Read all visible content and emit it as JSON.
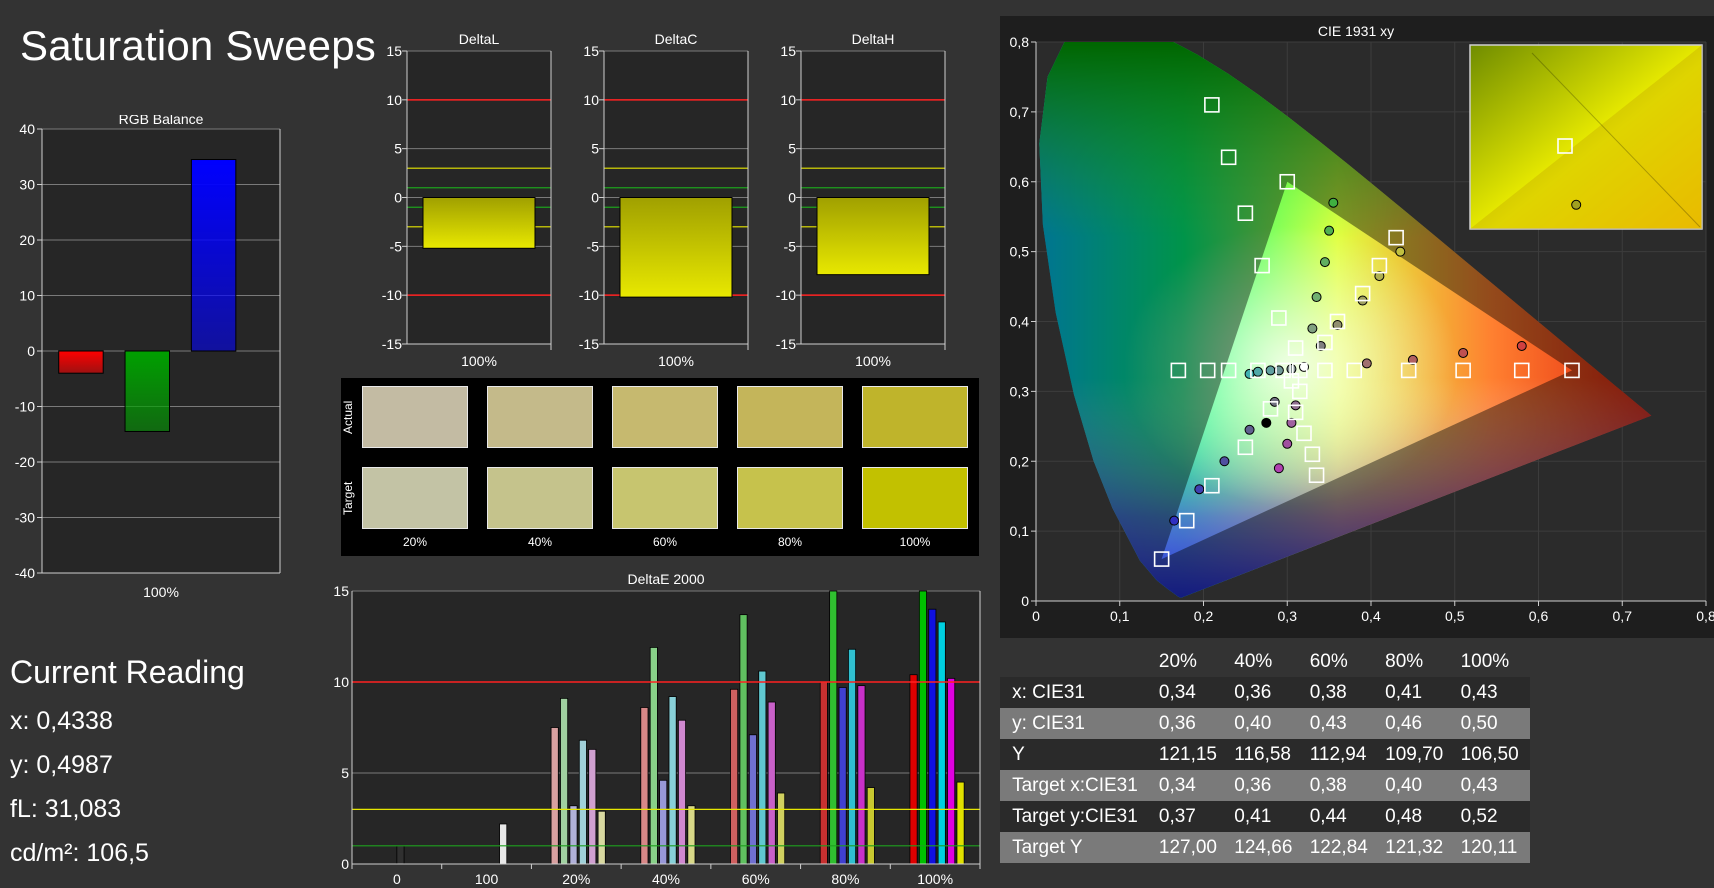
{
  "title": "Saturation Sweeps",
  "current_reading": {
    "title": "Current Reading",
    "lines": [
      "x: 0,4338",
      "y: 0,4987",
      "fL: 31,083",
      "cd/m²: 106,5"
    ]
  },
  "colors": {
    "background": "#333333",
    "panel": "#262626",
    "red_limit": "#ff2020",
    "yellow_limit": "#e6e600",
    "green_limit": "#1ea01e"
  },
  "chart_data": [
    {
      "id": "rgb-balance",
      "type": "bar",
      "title": "RGB Balance",
      "categories": [
        "Red",
        "Green",
        "Blue"
      ],
      "values": [
        -4,
        -14.5,
        34.5
      ],
      "colors": [
        "#ff0000",
        "#00a000",
        "#0000ff"
      ],
      "xlabel": "100%",
      "ylim": [
        -40,
        40
      ],
      "yticks": [
        "40",
        "30",
        "20",
        "10",
        "0",
        "-10",
        "-20",
        "-30",
        "-40"
      ]
    },
    {
      "id": "delta-l",
      "type": "bar",
      "title": "DeltaL",
      "categories": [
        "100%"
      ],
      "values": [
        -5.2
      ],
      "ylim": [
        -15,
        15
      ],
      "yticks": [
        "15",
        "10",
        "5",
        "0",
        "-5",
        "-10",
        "-15"
      ],
      "xlabel": "100%"
    },
    {
      "id": "delta-c",
      "type": "bar",
      "title": "DeltaC",
      "categories": [
        "100%"
      ],
      "values": [
        -10.2
      ],
      "ylim": [
        -15,
        15
      ],
      "yticks": [
        "15",
        "10",
        "5",
        "0",
        "-5",
        "-10",
        "-15"
      ],
      "xlabel": "100%"
    },
    {
      "id": "delta-h",
      "type": "bar",
      "title": "DeltaH",
      "categories": [
        "100%"
      ],
      "values": [
        -7.9
      ],
      "ylim": [
        -15,
        15
      ],
      "yticks": [
        "15",
        "10",
        "5",
        "0",
        "-5",
        "-10",
        "-15"
      ],
      "xlabel": "100%"
    },
    {
      "id": "delta-e-2000",
      "type": "bar",
      "title": "DeltaE 2000",
      "ylim": [
        0,
        15
      ],
      "yticks": [
        "15",
        "10",
        "5",
        "0"
      ],
      "xticks": [
        "0",
        "100",
        "20%",
        "40%",
        "60%",
        "80%",
        "100%"
      ],
      "limit_lines": [
        10,
        3,
        1
      ],
      "groups": [
        {
          "label": "0",
          "bars": [
            {
              "value": 1.0,
              "color": "#303030"
            }
          ]
        },
        {
          "label": "100",
          "bars": [
            {
              "value": 2.2,
              "color": "#e8e8e8"
            }
          ]
        },
        {
          "label": "20%",
          "bars": [
            {
              "value": 7.5,
              "color": "#d8a0a0"
            },
            {
              "value": 9.1,
              "color": "#a0d0a0"
            },
            {
              "value": 3.2,
              "color": "#b0b0d8"
            },
            {
              "value": 6.8,
              "color": "#a0d0d8"
            },
            {
              "value": 6.3,
              "color": "#d0a0d0"
            },
            {
              "value": 2.9,
              "color": "#d8d8a0"
            }
          ]
        },
        {
          "label": "40%",
          "bars": [
            {
              "value": 8.6,
              "color": "#d88888"
            },
            {
              "value": 11.9,
              "color": "#88d088"
            },
            {
              "value": 4.6,
              "color": "#9898d8"
            },
            {
              "value": 9.2,
              "color": "#88d0d8"
            },
            {
              "value": 7.9,
              "color": "#d088d0"
            },
            {
              "value": 3.2,
              "color": "#d8d888"
            }
          ]
        },
        {
          "label": "60%",
          "bars": [
            {
              "value": 9.6,
              "color": "#d06060"
            },
            {
              "value": 13.7,
              "color": "#60c060"
            },
            {
              "value": 7.1,
              "color": "#7070d0"
            },
            {
              "value": 10.6,
              "color": "#60c8d0"
            },
            {
              "value": 8.9,
              "color": "#c860c8"
            },
            {
              "value": 3.9,
              "color": "#d0d060"
            }
          ]
        },
        {
          "label": "80%",
          "bars": [
            {
              "value": 10.0,
              "color": "#c83030"
            },
            {
              "value": 15.0,
              "color": "#30c030"
            },
            {
              "value": 9.7,
              "color": "#4040d0"
            },
            {
              "value": 11.8,
              "color": "#30c0d0"
            },
            {
              "value": 9.8,
              "color": "#c830c8"
            },
            {
              "value": 4.2,
              "color": "#c8c830"
            }
          ]
        },
        {
          "label": "100%",
          "bars": [
            {
              "value": 10.4,
              "color": "#e00000"
            },
            {
              "value": 15.0,
              "color": "#00c000"
            },
            {
              "value": 14.0,
              "color": "#1010e0"
            },
            {
              "value": 13.3,
              "color": "#00d0e0"
            },
            {
              "value": 10.2,
              "color": "#e000e0"
            },
            {
              "value": 4.5,
              "color": "#e0e000"
            }
          ]
        }
      ]
    },
    {
      "id": "cie-1931",
      "type": "scatter",
      "title": "CIE 1931 xy",
      "xlim": [
        0,
        0.8
      ],
      "ylim": [
        0,
        0.8
      ],
      "xticks": [
        "0",
        "0,1",
        "0,2",
        "0,3",
        "0,4",
        "0,5",
        "0,6",
        "0,7",
        "0,8"
      ],
      "yticks": [
        "0",
        "0,1",
        "0,2",
        "0,3",
        "0,4",
        "0,5",
        "0,6",
        "0,7",
        "0,8"
      ],
      "targets": [
        [
          0.64,
          0.33
        ],
        [
          0.58,
          0.33
        ],
        [
          0.51,
          0.33
        ],
        [
          0.445,
          0.33
        ],
        [
          0.38,
          0.33
        ],
        [
          0.345,
          0.33
        ],
        [
          0.3,
          0.6
        ],
        [
          0.21,
          0.71
        ],
        [
          0.23,
          0.635
        ],
        [
          0.25,
          0.555
        ],
        [
          0.27,
          0.48
        ],
        [
          0.29,
          0.405
        ],
        [
          0.31,
          0.362
        ],
        [
          0.15,
          0.06
        ],
        [
          0.18,
          0.115
        ],
        [
          0.21,
          0.165
        ],
        [
          0.25,
          0.22
        ],
        [
          0.28,
          0.275
        ],
        [
          0.305,
          0.315
        ],
        [
          0.43,
          0.52
        ],
        [
          0.41,
          0.48
        ],
        [
          0.39,
          0.44
        ],
        [
          0.36,
          0.4
        ],
        [
          0.345,
          0.37
        ],
        [
          0.17,
          0.33
        ],
        [
          0.205,
          0.33
        ],
        [
          0.23,
          0.33
        ],
        [
          0.265,
          0.33
        ],
        [
          0.295,
          0.33
        ],
        [
          0.315,
          0.33
        ],
        [
          0.335,
          0.18
        ],
        [
          0.33,
          0.21
        ],
        [
          0.32,
          0.24
        ],
        [
          0.31,
          0.27
        ],
        [
          0.315,
          0.3
        ]
      ],
      "measured": [
        {
          "x": 0.58,
          "y": 0.365,
          "color": "#d04040"
        },
        {
          "x": 0.51,
          "y": 0.355,
          "color": "#c05050"
        },
        {
          "x": 0.45,
          "y": 0.345,
          "color": "#b06060"
        },
        {
          "x": 0.395,
          "y": 0.34,
          "color": "#a07070"
        },
        {
          "x": 0.355,
          "y": 0.57,
          "color": "#40b040"
        },
        {
          "x": 0.35,
          "y": 0.53,
          "color": "#50b050"
        },
        {
          "x": 0.345,
          "y": 0.485,
          "color": "#60b060"
        },
        {
          "x": 0.335,
          "y": 0.435,
          "color": "#70b070"
        },
        {
          "x": 0.33,
          "y": 0.39,
          "color": "#80a080"
        },
        {
          "x": 0.165,
          "y": 0.115,
          "color": "#3030c0"
        },
        {
          "x": 0.195,
          "y": 0.16,
          "color": "#4040b0"
        },
        {
          "x": 0.225,
          "y": 0.2,
          "color": "#5050a0"
        },
        {
          "x": 0.255,
          "y": 0.245,
          "color": "#606090"
        },
        {
          "x": 0.285,
          "y": 0.285,
          "color": "#707080"
        },
        {
          "x": 0.435,
          "y": 0.5,
          "color": "#c0c040"
        },
        {
          "x": 0.41,
          "y": 0.465,
          "color": "#b0b050"
        },
        {
          "x": 0.39,
          "y": 0.43,
          "color": "#a0a060"
        },
        {
          "x": 0.36,
          "y": 0.395,
          "color": "#909070"
        },
        {
          "x": 0.34,
          "y": 0.365,
          "color": "#808080"
        },
        {
          "x": 0.255,
          "y": 0.325,
          "color": "#40b0b0"
        },
        {
          "x": 0.265,
          "y": 0.328,
          "color": "#50a8a8"
        },
        {
          "x": 0.28,
          "y": 0.33,
          "color": "#60a0a0"
        },
        {
          "x": 0.29,
          "y": 0.33,
          "color": "#709898"
        },
        {
          "x": 0.305,
          "y": 0.332,
          "color": "#809090"
        },
        {
          "x": 0.29,
          "y": 0.19,
          "color": "#b040b0"
        },
        {
          "x": 0.3,
          "y": 0.225,
          "color": "#a050a0"
        },
        {
          "x": 0.305,
          "y": 0.255,
          "color": "#a060a0"
        },
        {
          "x": 0.31,
          "y": 0.28,
          "color": "#907090"
        },
        {
          "x": 0.275,
          "y": 0.255,
          "color": "#000000"
        },
        {
          "x": 0.32,
          "y": 0.335,
          "color": "#ffffff"
        }
      ],
      "inset": {
        "target": [
          0.43,
          0.52
        ],
        "measured": {
          "x": 0.434,
          "y": 0.499
        }
      }
    }
  ],
  "swatches": {
    "row_labels": {
      "actual": "Actual",
      "target": "Target"
    },
    "labels": [
      "20%",
      "40%",
      "60%",
      "80%",
      "100%"
    ],
    "actual": [
      "#c3bba3",
      "#c4ba8a",
      "#c6b96f",
      "#c4b55a",
      "#bfb42b"
    ],
    "target": [
      "#c3c3a5",
      "#c5c38c",
      "#c7c56f",
      "#c6c24c",
      "#c2c100"
    ]
  },
  "table": {
    "headers": [
      "20%",
      "40%",
      "60%",
      "80%",
      "100%"
    ],
    "rows": [
      {
        "label": "x: CIE31",
        "values": [
          "0,34",
          "0,36",
          "0,38",
          "0,41",
          "0,43"
        ]
      },
      {
        "label": "y: CIE31",
        "values": [
          "0,36",
          "0,40",
          "0,43",
          "0,46",
          "0,50"
        ]
      },
      {
        "label": "Y",
        "values": [
          "121,15",
          "116,58",
          "112,94",
          "109,70",
          "106,50"
        ]
      },
      {
        "label": "Target x:CIE31",
        "values": [
          "0,34",
          "0,36",
          "0,38",
          "0,40",
          "0,43"
        ]
      },
      {
        "label": "Target y:CIE31",
        "values": [
          "0,37",
          "0,41",
          "0,44",
          "0,48",
          "0,52"
        ]
      },
      {
        "label": "Target Y",
        "values": [
          "127,00",
          "124,66",
          "122,84",
          "121,32",
          "120,11"
        ]
      }
    ]
  }
}
